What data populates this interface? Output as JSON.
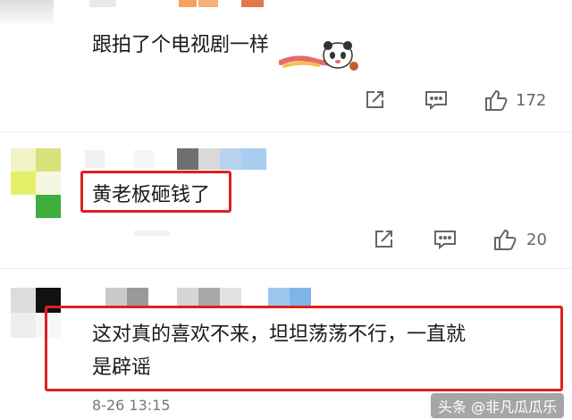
{
  "comments": [
    {
      "text": "跟拍了个电视剧一样",
      "sticker": "panda-sticker-icon",
      "actions": {
        "share_icon": "share-icon",
        "reply_icon": "reply-icon",
        "like_icon": "thumbs-up-icon",
        "like_count": "172"
      }
    },
    {
      "text": "黄老板砸钱了",
      "highlighted": true,
      "actions": {
        "share_icon": "share-icon",
        "reply_icon": "reply-icon",
        "like_icon": "thumbs-up-icon",
        "like_count": "20"
      }
    },
    {
      "text_line1": "这对真的喜欢不来，坦坦荡荡不行，一直就",
      "text_line2": "是辟谣",
      "highlighted": true,
      "timestamp": "8-26 13:15"
    }
  ],
  "watermark": "头条 @非凡瓜瓜乐",
  "colors": {
    "highlight_border": "#e02020",
    "divider": "#ececec",
    "icon": "#666666"
  }
}
